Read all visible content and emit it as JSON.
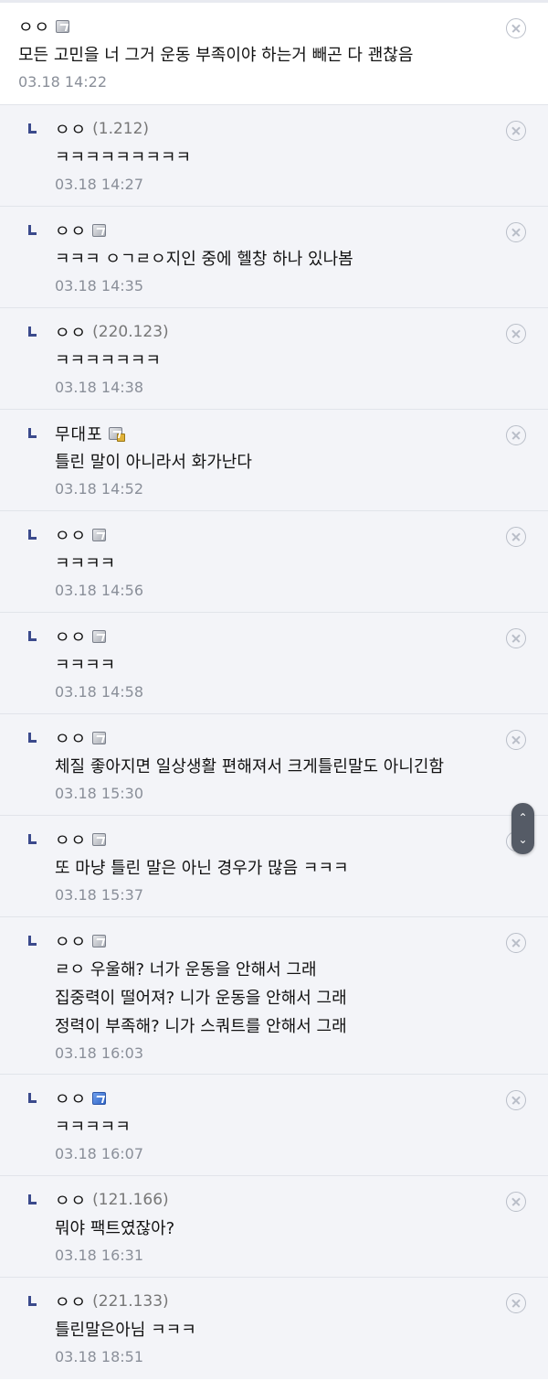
{
  "comments": [
    {
      "nick": "ㅇㅇ",
      "ip": "",
      "badge": "gray",
      "text": [
        "모든 고민을 너 그거 운동 부족이야 하는거 빼곤 다 괜찮음"
      ],
      "date": "03.18 14:22"
    },
    {
      "nick": "ㅇㅇ",
      "ip": "(1.212)",
      "badge": "",
      "text": [
        "ㅋㅋㅋㅋㅋㅋㅋㅋㅋ"
      ],
      "date": "03.18 14:27"
    },
    {
      "nick": "ㅇㅇ",
      "ip": "",
      "badge": "gray",
      "text": [
        "ㅋㅋㅋ ㅇㄱㄹㅇ지인 중에 헬창 하나 있나봄"
      ],
      "date": "03.18 14:35"
    },
    {
      "nick": "ㅇㅇ",
      "ip": "(220.123)",
      "badge": "",
      "text": [
        "ㅋㅋㅋㅋㅋㅋㅋ"
      ],
      "date": "03.18 14:38"
    },
    {
      "nick": "무대포",
      "ip": "",
      "badge": "gray-lock",
      "text": [
        "틀린 말이 아니라서 화가난다"
      ],
      "date": "03.18 14:52"
    },
    {
      "nick": "ㅇㅇ",
      "ip": "",
      "badge": "gray",
      "text": [
        "ㅋㅋㅋㅋ"
      ],
      "date": "03.18 14:56"
    },
    {
      "nick": "ㅇㅇ",
      "ip": "",
      "badge": "gray",
      "text": [
        "ㅋㅋㅋㅋ"
      ],
      "date": "03.18 14:58"
    },
    {
      "nick": "ㅇㅇ",
      "ip": "",
      "badge": "gray",
      "text": [
        "체질 좋아지면 일상생활 편해져서 크게틀린말도 아니긴함"
      ],
      "date": "03.18 15:30"
    },
    {
      "nick": "ㅇㅇ",
      "ip": "",
      "badge": "gray",
      "text": [
        "또 마냥 틀린 말은 아닌 경우가 많음 ㅋㅋㅋ"
      ],
      "date": "03.18 15:37"
    },
    {
      "nick": "ㅇㅇ",
      "ip": "",
      "badge": "gray",
      "text": [
        "ㄹㅇ 우울해? 너가 운동을 안해서 그래",
        "집중력이 떨어져? 니가 운동을 안해서 그래",
        "정력이 부족해? 니가 스쿼트를 안해서 그래"
      ],
      "date": "03.18 16:03"
    },
    {
      "nick": "ㅇㅇ",
      "ip": "",
      "badge": "blue",
      "text": [
        "ㅋㅋㅋㅋㅋ"
      ],
      "date": "03.18 16:07"
    },
    {
      "nick": "ㅇㅇ",
      "ip": "(121.166)",
      "badge": "",
      "text": [
        "뭐야 팩트였잖아?"
      ],
      "date": "03.18 16:31"
    },
    {
      "nick": "ㅇㅇ",
      "ip": "(221.133)",
      "badge": "",
      "text": [
        "틀린말은아님 ㅋㅋㅋ"
      ],
      "date": "03.18 18:51"
    }
  ],
  "scroll": {
    "up_icon": "chevron-up-icon",
    "down_icon": "chevron-down-icon"
  }
}
